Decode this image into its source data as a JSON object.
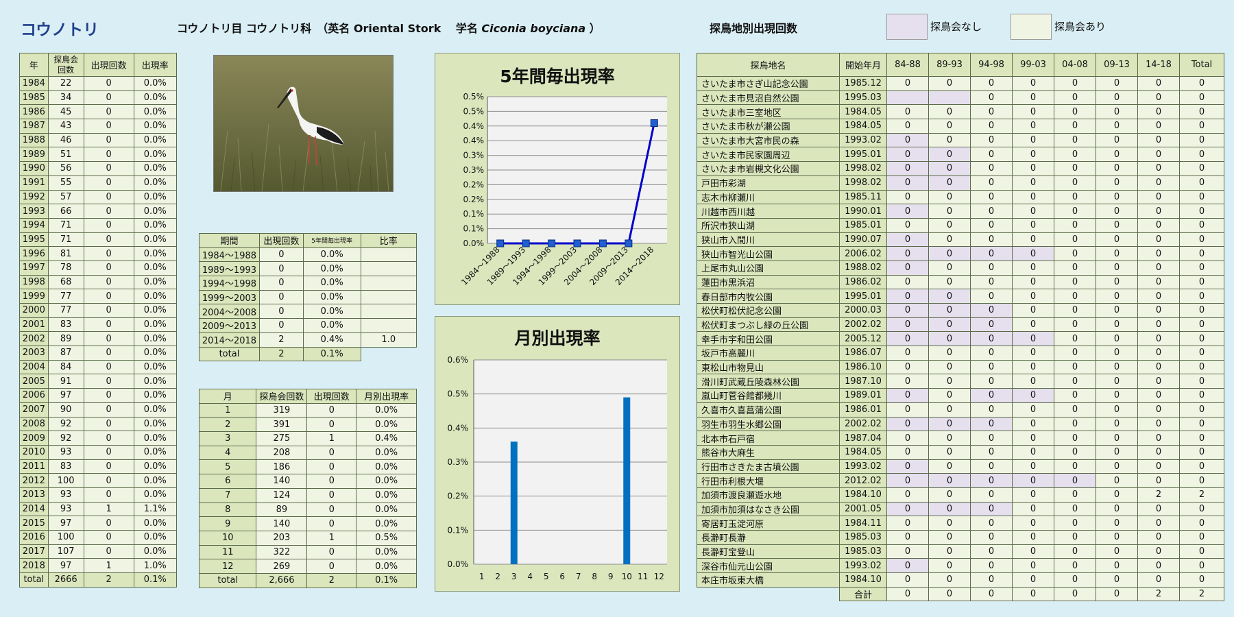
{
  "header": {
    "title": "コウノトリ",
    "species_prefix": "コウノトリ目 コウノトリ科　（英名 Oriental Stork　 学名 ",
    "scientific_name": "Ciconia boyciana",
    "species_suffix": " ）",
    "site_heading": "探鳥地別出現回数",
    "legend_no": "探鳥会なし",
    "legend_yes": "探鳥会あり"
  },
  "colors": {
    "no_survey": "#e6e0ee",
    "survey": "#f0f4e3",
    "header": "#dbe6bd",
    "line": "#0000cc",
    "bar": "#0070c0"
  },
  "yearly": {
    "headers": [
      "年",
      "探鳥会\n回数",
      "出現回数",
      "出現率"
    ],
    "rows": [
      [
        "1984",
        "22",
        "0",
        "0.0%"
      ],
      [
        "1985",
        "34",
        "0",
        "0.0%"
      ],
      [
        "1986",
        "45",
        "0",
        "0.0%"
      ],
      [
        "1987",
        "43",
        "0",
        "0.0%"
      ],
      [
        "1988",
        "46",
        "0",
        "0.0%"
      ],
      [
        "1989",
        "51",
        "0",
        "0.0%"
      ],
      [
        "1990",
        "56",
        "0",
        "0.0%"
      ],
      [
        "1991",
        "55",
        "0",
        "0.0%"
      ],
      [
        "1992",
        "57",
        "0",
        "0.0%"
      ],
      [
        "1993",
        "66",
        "0",
        "0.0%"
      ],
      [
        "1994",
        "71",
        "0",
        "0.0%"
      ],
      [
        "1995",
        "71",
        "0",
        "0.0%"
      ],
      [
        "1996",
        "81",
        "0",
        "0.0%"
      ],
      [
        "1997",
        "78",
        "0",
        "0.0%"
      ],
      [
        "1998",
        "68",
        "0",
        "0.0%"
      ],
      [
        "1999",
        "77",
        "0",
        "0.0%"
      ],
      [
        "2000",
        "77",
        "0",
        "0.0%"
      ],
      [
        "2001",
        "83",
        "0",
        "0.0%"
      ],
      [
        "2002",
        "89",
        "0",
        "0.0%"
      ],
      [
        "2003",
        "87",
        "0",
        "0.0%"
      ],
      [
        "2004",
        "84",
        "0",
        "0.0%"
      ],
      [
        "2005",
        "91",
        "0",
        "0.0%"
      ],
      [
        "2006",
        "97",
        "0",
        "0.0%"
      ],
      [
        "2007",
        "90",
        "0",
        "0.0%"
      ],
      [
        "2008",
        "92",
        "0",
        "0.0%"
      ],
      [
        "2009",
        "92",
        "0",
        "0.0%"
      ],
      [
        "2010",
        "93",
        "0",
        "0.0%"
      ],
      [
        "2011",
        "83",
        "0",
        "0.0%"
      ],
      [
        "2012",
        "100",
        "0",
        "0.0%"
      ],
      [
        "2013",
        "93",
        "0",
        "0.0%"
      ],
      [
        "2014",
        "93",
        "1",
        "1.1%"
      ],
      [
        "2015",
        "97",
        "0",
        "0.0%"
      ],
      [
        "2016",
        "100",
        "0",
        "0.0%"
      ],
      [
        "2017",
        "107",
        "0",
        "0.0%"
      ],
      [
        "2018",
        "97",
        "1",
        "1.0%"
      ]
    ],
    "total": [
      "total",
      "2666",
      "2",
      "0.1%"
    ]
  },
  "period_table": {
    "headers": [
      "期間",
      "出現回数",
      "5年間毎出現率",
      "比率"
    ],
    "rows": [
      [
        "1984～1988",
        "0",
        "0.0%",
        ""
      ],
      [
        "1989～1993",
        "0",
        "0.0%",
        ""
      ],
      [
        "1994～1998",
        "0",
        "0.0%",
        ""
      ],
      [
        "1999～2003",
        "0",
        "0.0%",
        ""
      ],
      [
        "2004～2008",
        "0",
        "0.0%",
        ""
      ],
      [
        "2009～2013",
        "0",
        "0.0%",
        ""
      ],
      [
        "2014～2018",
        "2",
        "0.4%",
        "1.0"
      ]
    ],
    "total": [
      "total",
      "2",
      "0.1%"
    ]
  },
  "month_table": {
    "headers": [
      "月",
      "探鳥会回数",
      "出現回数",
      "月別出現率"
    ],
    "rows": [
      [
        "1",
        "319",
        "0",
        "0.0%"
      ],
      [
        "2",
        "391",
        "0",
        "0.0%"
      ],
      [
        "3",
        "275",
        "1",
        "0.4%"
      ],
      [
        "4",
        "208",
        "0",
        "0.0%"
      ],
      [
        "5",
        "186",
        "0",
        "0.0%"
      ],
      [
        "6",
        "140",
        "0",
        "0.0%"
      ],
      [
        "7",
        "124",
        "0",
        "0.0%"
      ],
      [
        "8",
        "89",
        "0",
        "0.0%"
      ],
      [
        "9",
        "140",
        "0",
        "0.0%"
      ],
      [
        "10",
        "203",
        "1",
        "0.5%"
      ],
      [
        "11",
        "322",
        "0",
        "0.0%"
      ],
      [
        "12",
        "269",
        "0",
        "0.0%"
      ]
    ],
    "total": [
      "total",
      "2,666",
      "2",
      "0.1%"
    ]
  },
  "sites": {
    "headers": [
      "探鳥地名",
      "開始年月",
      "84-88",
      "89-93",
      "94-98",
      "99-03",
      "04-08",
      "09-13",
      "14-18",
      "Total"
    ],
    "rows": [
      {
        "name": "さいたま市さぎ山記念公園",
        "start": "1985.12",
        "v": [
          "0",
          "0",
          "0",
          "0",
          "0",
          "0",
          "0",
          "0"
        ],
        "nos": []
      },
      {
        "name": "さいたま市見沼自然公園",
        "start": "1995.03",
        "v": [
          "",
          "",
          "0",
          "0",
          "0",
          "0",
          "0",
          "0"
        ],
        "nos": [
          0,
          1
        ]
      },
      {
        "name": "さいたま市三室地区",
        "start": "1984.05",
        "v": [
          "0",
          "0",
          "0",
          "0",
          "0",
          "0",
          "0",
          "0"
        ],
        "nos": []
      },
      {
        "name": "さいたま市秋が瀬公園",
        "start": "1984.05",
        "v": [
          "0",
          "0",
          "0",
          "0",
          "0",
          "0",
          "0",
          "0"
        ],
        "nos": []
      },
      {
        "name": "さいたま市大宮市民の森",
        "start": "1993.02",
        "v": [
          "0",
          "0",
          "0",
          "0",
          "0",
          "0",
          "0",
          "0"
        ],
        "nos": [
          0
        ]
      },
      {
        "name": "さいたま市民家園周辺",
        "start": "1995.01",
        "v": [
          "0",
          "0",
          "0",
          "0",
          "0",
          "0",
          "0",
          "0"
        ],
        "nos": [
          0,
          1
        ]
      },
      {
        "name": "さいたま市岩槻文化公園",
        "start": "1998.02",
        "v": [
          "0",
          "0",
          "0",
          "0",
          "0",
          "0",
          "0",
          "0"
        ],
        "nos": [
          0,
          1
        ]
      },
      {
        "name": "戸田市彩湖",
        "start": "1998.02",
        "v": [
          "0",
          "0",
          "0",
          "0",
          "0",
          "0",
          "0",
          "0"
        ],
        "nos": [
          0,
          1
        ]
      },
      {
        "name": "志木市柳瀬川",
        "start": "1985.11",
        "v": [
          "0",
          "0",
          "0",
          "0",
          "0",
          "0",
          "0",
          "0"
        ],
        "nos": []
      },
      {
        "name": "川越市西川越",
        "start": "1990.01",
        "v": [
          "0",
          "0",
          "0",
          "0",
          "0",
          "0",
          "0",
          "0"
        ],
        "nos": [
          0
        ]
      },
      {
        "name": "所沢市狭山湖",
        "start": "1985.01",
        "v": [
          "0",
          "0",
          "0",
          "0",
          "0",
          "0",
          "0",
          "0"
        ],
        "nos": []
      },
      {
        "name": "狭山市入間川",
        "start": "1990.07",
        "v": [
          "0",
          "0",
          "0",
          "0",
          "0",
          "0",
          "0",
          "0"
        ],
        "nos": [
          0
        ]
      },
      {
        "name": "狭山市智光山公園",
        "start": "2006.02",
        "v": [
          "0",
          "0",
          "0",
          "0",
          "0",
          "0",
          "0",
          "0"
        ],
        "nos": [
          0,
          1,
          2,
          3
        ]
      },
      {
        "name": "上尾市丸山公園",
        "start": "1988.02",
        "v": [
          "0",
          "0",
          "0",
          "0",
          "0",
          "0",
          "0",
          "0"
        ],
        "nos": [
          0
        ]
      },
      {
        "name": "蓮田市黒浜沼",
        "start": "1986.02",
        "v": [
          "0",
          "0",
          "0",
          "0",
          "0",
          "0",
          "0",
          "0"
        ],
        "nos": []
      },
      {
        "name": "春日部市内牧公園",
        "start": "1995.01",
        "v": [
          "0",
          "0",
          "0",
          "0",
          "0",
          "0",
          "0",
          "0"
        ],
        "nos": [
          0,
          1
        ]
      },
      {
        "name": "松伏町松伏記念公園",
        "start": "2000.03",
        "v": [
          "0",
          "0",
          "0",
          "0",
          "0",
          "0",
          "0",
          "0"
        ],
        "nos": [
          0,
          1,
          2
        ]
      },
      {
        "name": "松伏町まつぶし緑の丘公園",
        "start": "2002.02",
        "v": [
          "0",
          "0",
          "0",
          "0",
          "0",
          "0",
          "0",
          "0"
        ],
        "nos": [
          0,
          1,
          2
        ]
      },
      {
        "name": "幸手市宇和田公園",
        "start": "2005.12",
        "v": [
          "0",
          "0",
          "0",
          "0",
          "0",
          "0",
          "0",
          "0"
        ],
        "nos": [
          0,
          1,
          2,
          3
        ]
      },
      {
        "name": "坂戸市高麗川",
        "start": "1986.07",
        "v": [
          "0",
          "0",
          "0",
          "0",
          "0",
          "0",
          "0",
          "0"
        ],
        "nos": []
      },
      {
        "name": "東松山市物見山",
        "start": "1986.10",
        "v": [
          "0",
          "0",
          "0",
          "0",
          "0",
          "0",
          "0",
          "0"
        ],
        "nos": []
      },
      {
        "name": "滑川町武蔵丘陵森林公園",
        "start": "1987.10",
        "v": [
          "0",
          "0",
          "0",
          "0",
          "0",
          "0",
          "0",
          "0"
        ],
        "nos": []
      },
      {
        "name": "嵐山町菅谷館都幾川",
        "start": "1989.01",
        "v": [
          "0",
          "0",
          "0",
          "0",
          "0",
          "0",
          "0",
          "0"
        ],
        "nos": [
          0,
          2,
          3
        ]
      },
      {
        "name": "久喜市久喜菖蒲公園",
        "start": "1986.01",
        "v": [
          "0",
          "0",
          "0",
          "0",
          "0",
          "0",
          "0",
          "0"
        ],
        "nos": []
      },
      {
        "name": "羽生市羽生水郷公園",
        "start": "2002.02",
        "v": [
          "0",
          "0",
          "0",
          "0",
          "0",
          "0",
          "0",
          "0"
        ],
        "nos": [
          0,
          1,
          2
        ]
      },
      {
        "name": "北本市石戸宿",
        "start": "1987.04",
        "v": [
          "0",
          "0",
          "0",
          "0",
          "0",
          "0",
          "0",
          "0"
        ],
        "nos": []
      },
      {
        "name": "熊谷市大麻生",
        "start": "1984.05",
        "v": [
          "0",
          "0",
          "0",
          "0",
          "0",
          "0",
          "0",
          "0"
        ],
        "nos": []
      },
      {
        "name": "行田市さきたま古墳公園",
        "start": "1993.02",
        "v": [
          "0",
          "0",
          "0",
          "0",
          "0",
          "0",
          "0",
          "0"
        ],
        "nos": [
          0
        ]
      },
      {
        "name": "行田市利根大堰",
        "start": "2012.02",
        "v": [
          "0",
          "0",
          "0",
          "0",
          "0",
          "0",
          "0",
          "0"
        ],
        "nos": [
          0,
          1,
          2,
          3,
          4
        ]
      },
      {
        "name": "加須市渡良瀬遊水地",
        "start": "1984.10",
        "v": [
          "0",
          "0",
          "0",
          "0",
          "0",
          "0",
          "2",
          "2"
        ],
        "nos": []
      },
      {
        "name": "加須市加須はなさき公園",
        "start": "2001.05",
        "v": [
          "0",
          "0",
          "0",
          "0",
          "0",
          "0",
          "0",
          "0"
        ],
        "nos": [
          0,
          1,
          2
        ]
      },
      {
        "name": "寄居町玉淀河原",
        "start": "1984.11",
        "v": [
          "0",
          "0",
          "0",
          "0",
          "0",
          "0",
          "0",
          "0"
        ],
        "nos": []
      },
      {
        "name": "長瀞町長瀞",
        "start": "1985.03",
        "v": [
          "0",
          "0",
          "0",
          "0",
          "0",
          "0",
          "0",
          "0"
        ],
        "nos": []
      },
      {
        "name": "長瀞町宝登山",
        "start": "1985.03",
        "v": [
          "0",
          "0",
          "0",
          "0",
          "0",
          "0",
          "0",
          "0"
        ],
        "nos": []
      },
      {
        "name": "深谷市仙元山公園",
        "start": "1993.02",
        "v": [
          "0",
          "0",
          "0",
          "0",
          "0",
          "0",
          "0",
          "0"
        ],
        "nos": [
          0
        ]
      },
      {
        "name": "本庄市坂東大橋",
        "start": "1984.10",
        "v": [
          "0",
          "0",
          "0",
          "0",
          "0",
          "0",
          "0",
          "0"
        ],
        "nos": []
      }
    ],
    "total_label": "合計",
    "total": [
      "0",
      "0",
      "0",
      "0",
      "0",
      "0",
      "2",
      "2"
    ]
  },
  "chart_data": [
    {
      "type": "line",
      "title": "5年間毎出現率",
      "categories": [
        "1984～1988",
        "1989～1993",
        "1994～1998",
        "1999～2003",
        "2004～2008",
        "2009～2013",
        "2014～2018"
      ],
      "values": [
        0,
        0,
        0,
        0,
        0,
        0,
        0.41
      ],
      "ylim": [
        0,
        0.5
      ],
      "yticks": [
        "0.0%",
        "0.1%",
        "0.1%",
        "0.2%",
        "0.2%",
        "0.3%",
        "0.3%",
        "0.4%",
        "0.4%",
        "0.5%",
        "0.5%"
      ],
      "grid": true
    },
    {
      "type": "bar",
      "title": "月別出現率",
      "categories": [
        "1",
        "2",
        "3",
        "4",
        "5",
        "6",
        "7",
        "8",
        "9",
        "10",
        "11",
        "12"
      ],
      "values": [
        0,
        0,
        0.36,
        0,
        0,
        0,
        0,
        0,
        0,
        0.49,
        0,
        0
      ],
      "ylim": [
        0,
        0.6
      ],
      "yticks": [
        "0.0%",
        "0.1%",
        "0.2%",
        "0.3%",
        "0.4%",
        "0.5%",
        "0.6%"
      ],
      "grid": true
    }
  ]
}
